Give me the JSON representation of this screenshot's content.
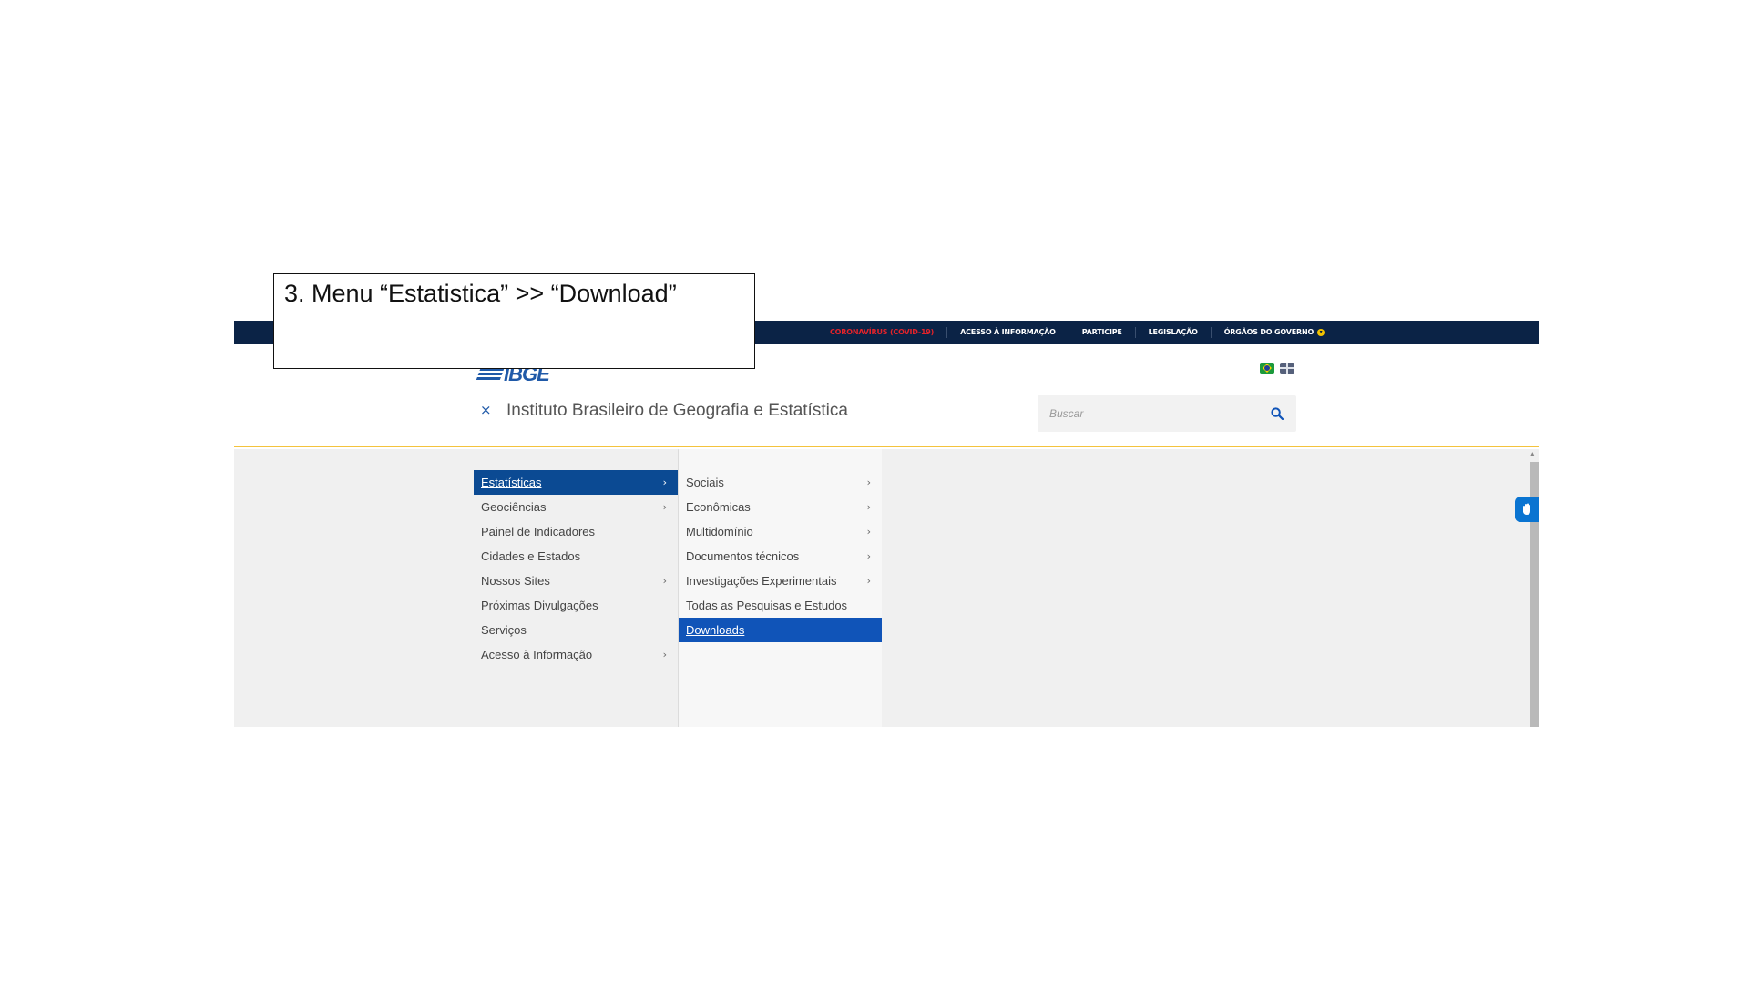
{
  "annotation": {
    "text": "3. Menu “Estatistica” >> “Download”"
  },
  "gov_bar": {
    "links": [
      {
        "label": "CORONAVÍRUS (COVID-19)"
      },
      {
        "label": "ACESSO À INFORMAÇÃO"
      },
      {
        "label": "PARTICIPE"
      },
      {
        "label": "LEGISLAÇÃO"
      },
      {
        "label": "ÓRGÃOS DO GOVERNO"
      }
    ]
  },
  "header": {
    "logo_text": "IBGE",
    "close_symbol": "×",
    "institution_title": "Instituto Brasileiro de Geografia e Estatística",
    "search": {
      "placeholder": "Buscar"
    }
  },
  "menu": {
    "main_items": [
      {
        "label": "Estatísticas",
        "has_submenu": true,
        "active": true
      },
      {
        "label": "Geociências",
        "has_submenu": true
      },
      {
        "label": "Painel de Indicadores"
      },
      {
        "label": "Cidades e Estados"
      },
      {
        "label": "Nossos Sites",
        "has_submenu": true
      },
      {
        "label": "Próximas Divulgações"
      },
      {
        "label": "Serviços"
      },
      {
        "label": "Acesso à Informação",
        "has_submenu": true
      }
    ],
    "sub_items": [
      {
        "label": "Sociais",
        "has_submenu": true
      },
      {
        "label": "Econômicas",
        "has_submenu": true
      },
      {
        "label": "Multidomínio",
        "has_submenu": true
      },
      {
        "label": "Documentos técnicos",
        "has_submenu": true
      },
      {
        "label": "Investigações Experimentais",
        "has_submenu": true
      },
      {
        "label": "Todas as Pesquisas e Estudos"
      },
      {
        "label": "Downloads",
        "active": true
      }
    ],
    "arrow_symbol": "›"
  },
  "colors": {
    "gov_bar": "#0b2346",
    "accent_blue": "#1054b8",
    "active_main": "#0b4a93",
    "header_border": "#f4c33d",
    "covid_red": "#e3232a"
  },
  "icons": [
    "close-icon",
    "search-icon",
    "brazil-flag-icon",
    "uk-flag-icon",
    "chevron-right-icon",
    "hand-sign-icon"
  ]
}
